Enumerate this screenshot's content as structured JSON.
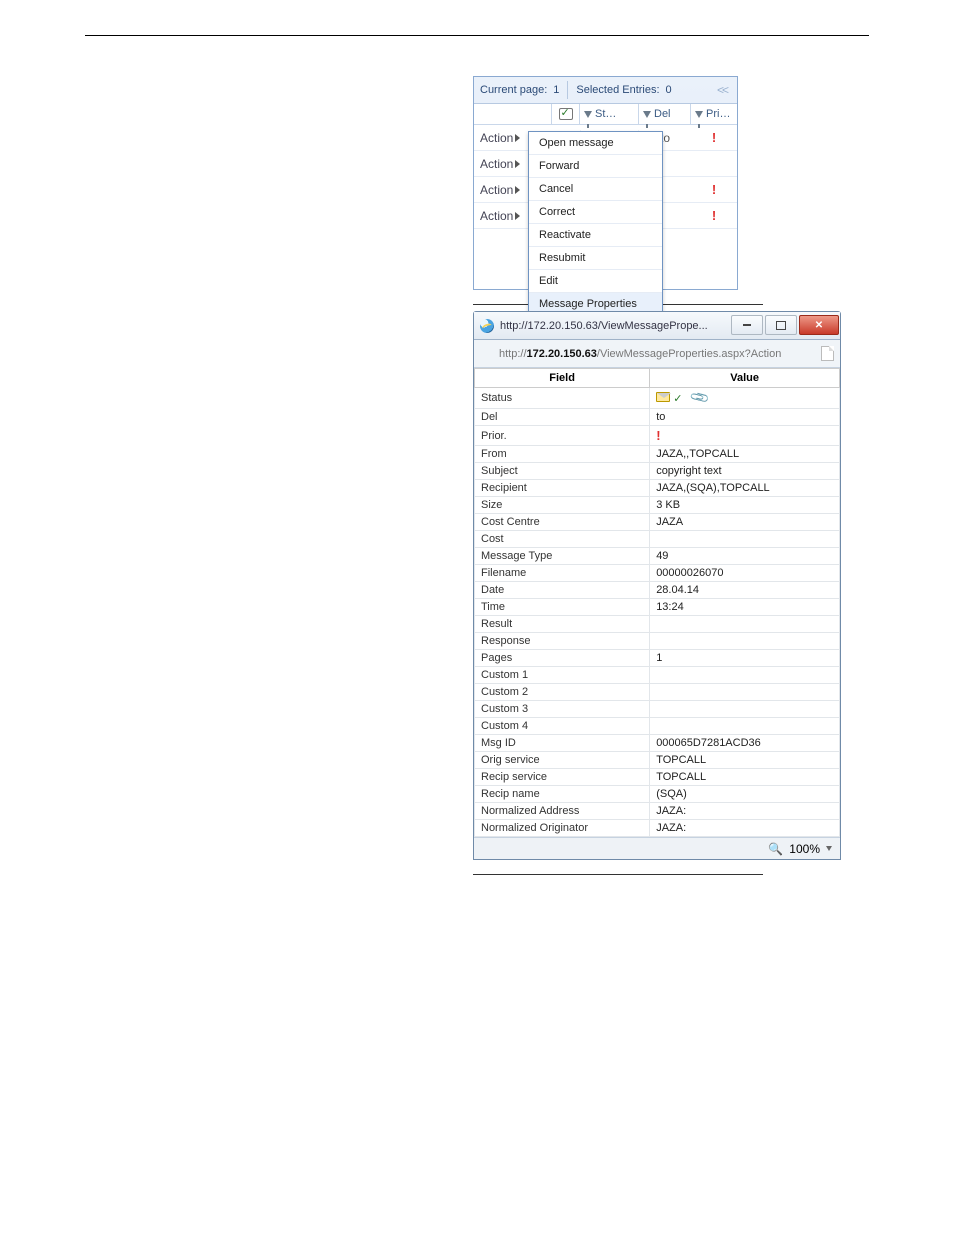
{
  "grid": {
    "currentPageLabel": "Current page:",
    "currentPage": "1",
    "selectedLabel": "Selected Entries:",
    "selectedCount": "0",
    "collapse": "<<",
    "cols": {
      "st": "St…",
      "del": "Del",
      "pri": "Pri…"
    },
    "rows": [
      {
        "action": "Action",
        "del": "to",
        "pri": "!"
      },
      {
        "action": "Action",
        "del": "",
        "pri": ""
      },
      {
        "action": "Action",
        "del": "",
        "pri": "!"
      },
      {
        "action": "Action",
        "del": "",
        "pri": "!"
      }
    ],
    "menu": [
      "Open message",
      "Forward",
      "Cancel",
      "Correct",
      "Reactivate",
      "Resubmit",
      "Edit",
      "Message Properties"
    ]
  },
  "iewin": {
    "title": "http://172.20.150.63/ViewMessagePrope...",
    "addrPrefix": "http://",
    "addrBold": "172.20.150.63",
    "addrRest": "/ViewMessageProperties.aspx?Action",
    "headerField": "Field",
    "headerValue": "Value",
    "rows": [
      {
        "f": "Status",
        "v": ""
      },
      {
        "f": "Del",
        "v": "to"
      },
      {
        "f": "Prior.",
        "v": ""
      },
      {
        "f": "From",
        "v": "JAZA,,TOPCALL"
      },
      {
        "f": "Subject",
        "v": "copyright text"
      },
      {
        "f": "Recipient",
        "v": "JAZA,(SQA),TOPCALL"
      },
      {
        "f": "Size",
        "v": "3 KB"
      },
      {
        "f": "Cost Centre",
        "v": "JAZA"
      },
      {
        "f": "Cost",
        "v": ""
      },
      {
        "f": "Message Type",
        "v": "49"
      },
      {
        "f": "Filename",
        "v": "00000026070"
      },
      {
        "f": "Date",
        "v": "28.04.14"
      },
      {
        "f": "Time",
        "v": "13:24"
      },
      {
        "f": "Result",
        "v": ""
      },
      {
        "f": "Response",
        "v": ""
      },
      {
        "f": "Pages",
        "v": "1"
      },
      {
        "f": "Custom 1",
        "v": ""
      },
      {
        "f": "Custom 2",
        "v": ""
      },
      {
        "f": "Custom 3",
        "v": ""
      },
      {
        "f": "Custom 4",
        "v": ""
      },
      {
        "f": "Msg ID",
        "v": "000065D7281ACD36"
      },
      {
        "f": "Orig service",
        "v": "TOPCALL"
      },
      {
        "f": "Recip service",
        "v": "TOPCALL"
      },
      {
        "f": "Recip name",
        "v": "(SQA)"
      },
      {
        "f": "Normalized Address",
        "v": "JAZA:"
      },
      {
        "f": "Normalized Originator",
        "v": "JAZA:"
      }
    ],
    "zoom": "100%"
  }
}
